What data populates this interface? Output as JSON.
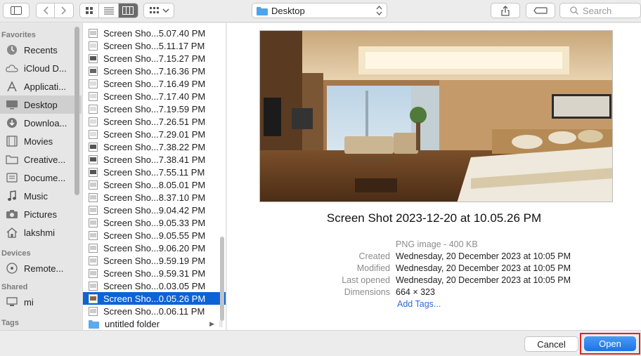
{
  "toolbar": {
    "path_label": "Desktop",
    "search_placeholder": "Search"
  },
  "sidebar": {
    "favorites_header": "Favorites",
    "favorites": [
      {
        "label": "Recents",
        "icon": "clock-icon"
      },
      {
        "label": "iCloud D...",
        "icon": "cloud-icon"
      },
      {
        "label": "Applicati...",
        "icon": "applications-icon"
      },
      {
        "label": "Desktop",
        "icon": "desktop-icon",
        "selected": true
      },
      {
        "label": "Downloa...",
        "icon": "download-icon"
      },
      {
        "label": "Movies",
        "icon": "film-icon"
      },
      {
        "label": "Creative...",
        "icon": "folder-icon"
      },
      {
        "label": "Docume...",
        "icon": "document-icon"
      },
      {
        "label": "Music",
        "icon": "music-note-icon"
      },
      {
        "label": "Pictures",
        "icon": "camera-icon"
      },
      {
        "label": "lakshmi",
        "icon": "home-icon"
      }
    ],
    "devices_header": "Devices",
    "devices": [
      {
        "label": "Remote...",
        "icon": "disc-icon"
      }
    ],
    "shared_header": "Shared",
    "shared": [
      {
        "label": "mi",
        "icon": "monitor-icon"
      }
    ],
    "tags_header_partial": "Tags"
  },
  "files": [
    {
      "label": "Screen Sho...5.07.40 PM"
    },
    {
      "label": "Screen Sho...5.11.17 PM"
    },
    {
      "label": "Screen Sho...7.15.27 PM"
    },
    {
      "label": "Screen Sho...7.16.36 PM"
    },
    {
      "label": "Screen Sho...7.16.49 PM"
    },
    {
      "label": "Screen Sho...7.17.40 PM"
    },
    {
      "label": "Screen Sho...7.19.59 PM"
    },
    {
      "label": "Screen Sho...7.26.51 PM"
    },
    {
      "label": "Screen Sho...7.29.01 PM"
    },
    {
      "label": "Screen Sho...7.38.22 PM"
    },
    {
      "label": "Screen Sho...7.38.41 PM"
    },
    {
      "label": "Screen Sho...7.55.11 PM"
    },
    {
      "label": "Screen Sho...8.05.01 PM"
    },
    {
      "label": "Screen Sho...8.37.10 PM"
    },
    {
      "label": "Screen Sho...9.04.42 PM"
    },
    {
      "label": "Screen Sho...9.05.33 PM"
    },
    {
      "label": "Screen Sho...9.05.55 PM"
    },
    {
      "label": "Screen Sho...9.06.20 PM"
    },
    {
      "label": "Screen Sho...9.59.19 PM"
    },
    {
      "label": "Screen Sho...9.59.31 PM"
    },
    {
      "label": "Screen Sho...0.03.05 PM"
    },
    {
      "label": "Screen Sho...0.05.26 PM",
      "selected": true
    },
    {
      "label": "Screen Sho...0.06.11 PM"
    },
    {
      "label": "untitled folder",
      "folder": true
    }
  ],
  "preview": {
    "title": "Screen Shot 2023-12-20 at 10.05.26 PM",
    "kind": "PNG image - 400 KB",
    "created_label": "Created",
    "created_value": "Wednesday, 20 December 2023 at 10:05 PM",
    "modified_label": "Modified",
    "modified_value": "Wednesday, 20 December 2023 at 10:05 PM",
    "opened_label": "Last opened",
    "opened_value": "Wednesday, 20 December 2023 at 10:05 PM",
    "dimensions_label": "Dimensions",
    "dimensions_value": "664 × 323",
    "add_tags": "Add Tags..."
  },
  "buttons": {
    "cancel": "Cancel",
    "open": "Open"
  }
}
